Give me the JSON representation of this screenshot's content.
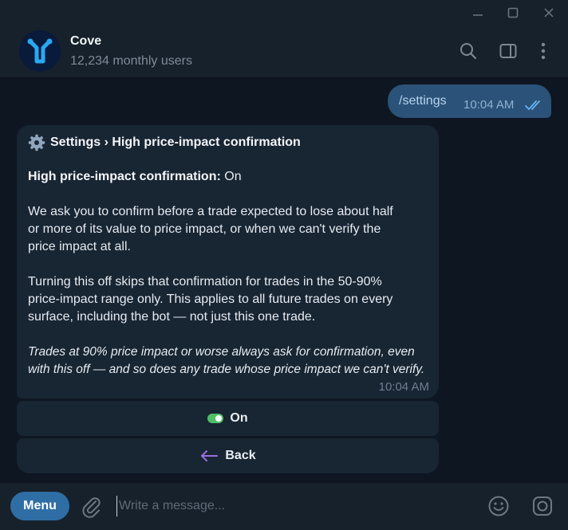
{
  "header": {
    "title": "Cove",
    "subtitle": "12,234 monthly users"
  },
  "outgoing": {
    "text": "/settings",
    "time": "10:04 AM"
  },
  "incoming": {
    "title": "Settings › High price-impact confirmation",
    "status_label": "High price-impact confirmation:",
    "status_value": "On",
    "para1": [
      "We ask you to confirm before a trade expected to lose about half",
      "or more of its value to price impact, or when we can't verify the",
      "price impact at all."
    ],
    "para2": [
      "Turning this off skips that confirmation for trades in the 50-90%",
      "price-impact range only. This applies to all future trades on every",
      "surface, including the bot — not just this one trade."
    ],
    "note": [
      "Trades at 90% price impact or worse always ask for confirmation, even",
      "with this off — and so does any trade whose price impact we can't verify."
    ],
    "time": "10:04 AM"
  },
  "keyboard": {
    "toggle_label": "On",
    "back_label": "Back"
  },
  "composer": {
    "menu_label": "Menu",
    "placeholder": "Write a message..."
  },
  "colors": {
    "toggle_on": "#4fbf67",
    "back_arrow": "#9b6fe0",
    "accent": "#2f6ea5",
    "ticks": "#6ab3f3"
  }
}
